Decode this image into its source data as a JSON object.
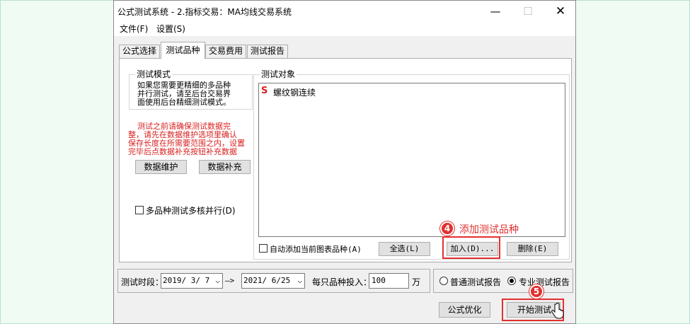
{
  "window": {
    "title": "公式测试系统 - 2.指标交易：MA均线交易系统",
    "minimize_glyph": "—",
    "maximize_glyph": "☐",
    "close_glyph": "✕"
  },
  "menu": {
    "file": "文件(F)",
    "settings": "设置(S)"
  },
  "tabs": [
    {
      "label": "公式选择"
    },
    {
      "label": "测试品种"
    },
    {
      "label": "交易费用"
    },
    {
      "label": "测试报告"
    }
  ],
  "test_mode": {
    "legend": "测试模式",
    "desc_lines": [
      "如果您需要更精细的多品种",
      "并行测试，请至后台交易界",
      "面使用后台精细测试模式。"
    ],
    "warning_lines": [
      "测试之前请确保测试数据完",
      "整，请先在数据维护选项里确认",
      "保存长度在所需要范围之内，设置",
      "完毕后点数据补充按钮补充数据"
    ],
    "data_maintain_btn": "数据维护",
    "data_supplement_btn": "数据补充",
    "multi_core_checkbox": "多品种测试多核并行(D)"
  },
  "test_objects": {
    "legend": "测试对象",
    "items": [
      {
        "icon": "S",
        "name": "螺纹钢连续"
      }
    ],
    "auto_add_checkbox": "自动添加当前图表品种(A)",
    "select_all_btn": "全选(L)",
    "add_btn": "加入(D)...",
    "delete_btn": "删除(E)"
  },
  "bottom": {
    "period_label": "测试时段：",
    "start_date": "2019/ 3/ 7",
    "arrow": "—>",
    "end_date": "2021/ 6/25",
    "invest_label": "每只品种投入：",
    "invest_value": "100",
    "unit": "万",
    "normal_report": "普通测试报告",
    "pro_report": "专业测试报告",
    "formula_optimize_btn": "公式优化",
    "start_test_btn": "开始测试"
  },
  "annotations": {
    "badge4": "4",
    "text4": "添加测试品种",
    "badge5": "5"
  },
  "colors": {
    "annotation_red": "#e23030",
    "warning_red": "#d82020",
    "item_icon_red": "#d82020"
  }
}
